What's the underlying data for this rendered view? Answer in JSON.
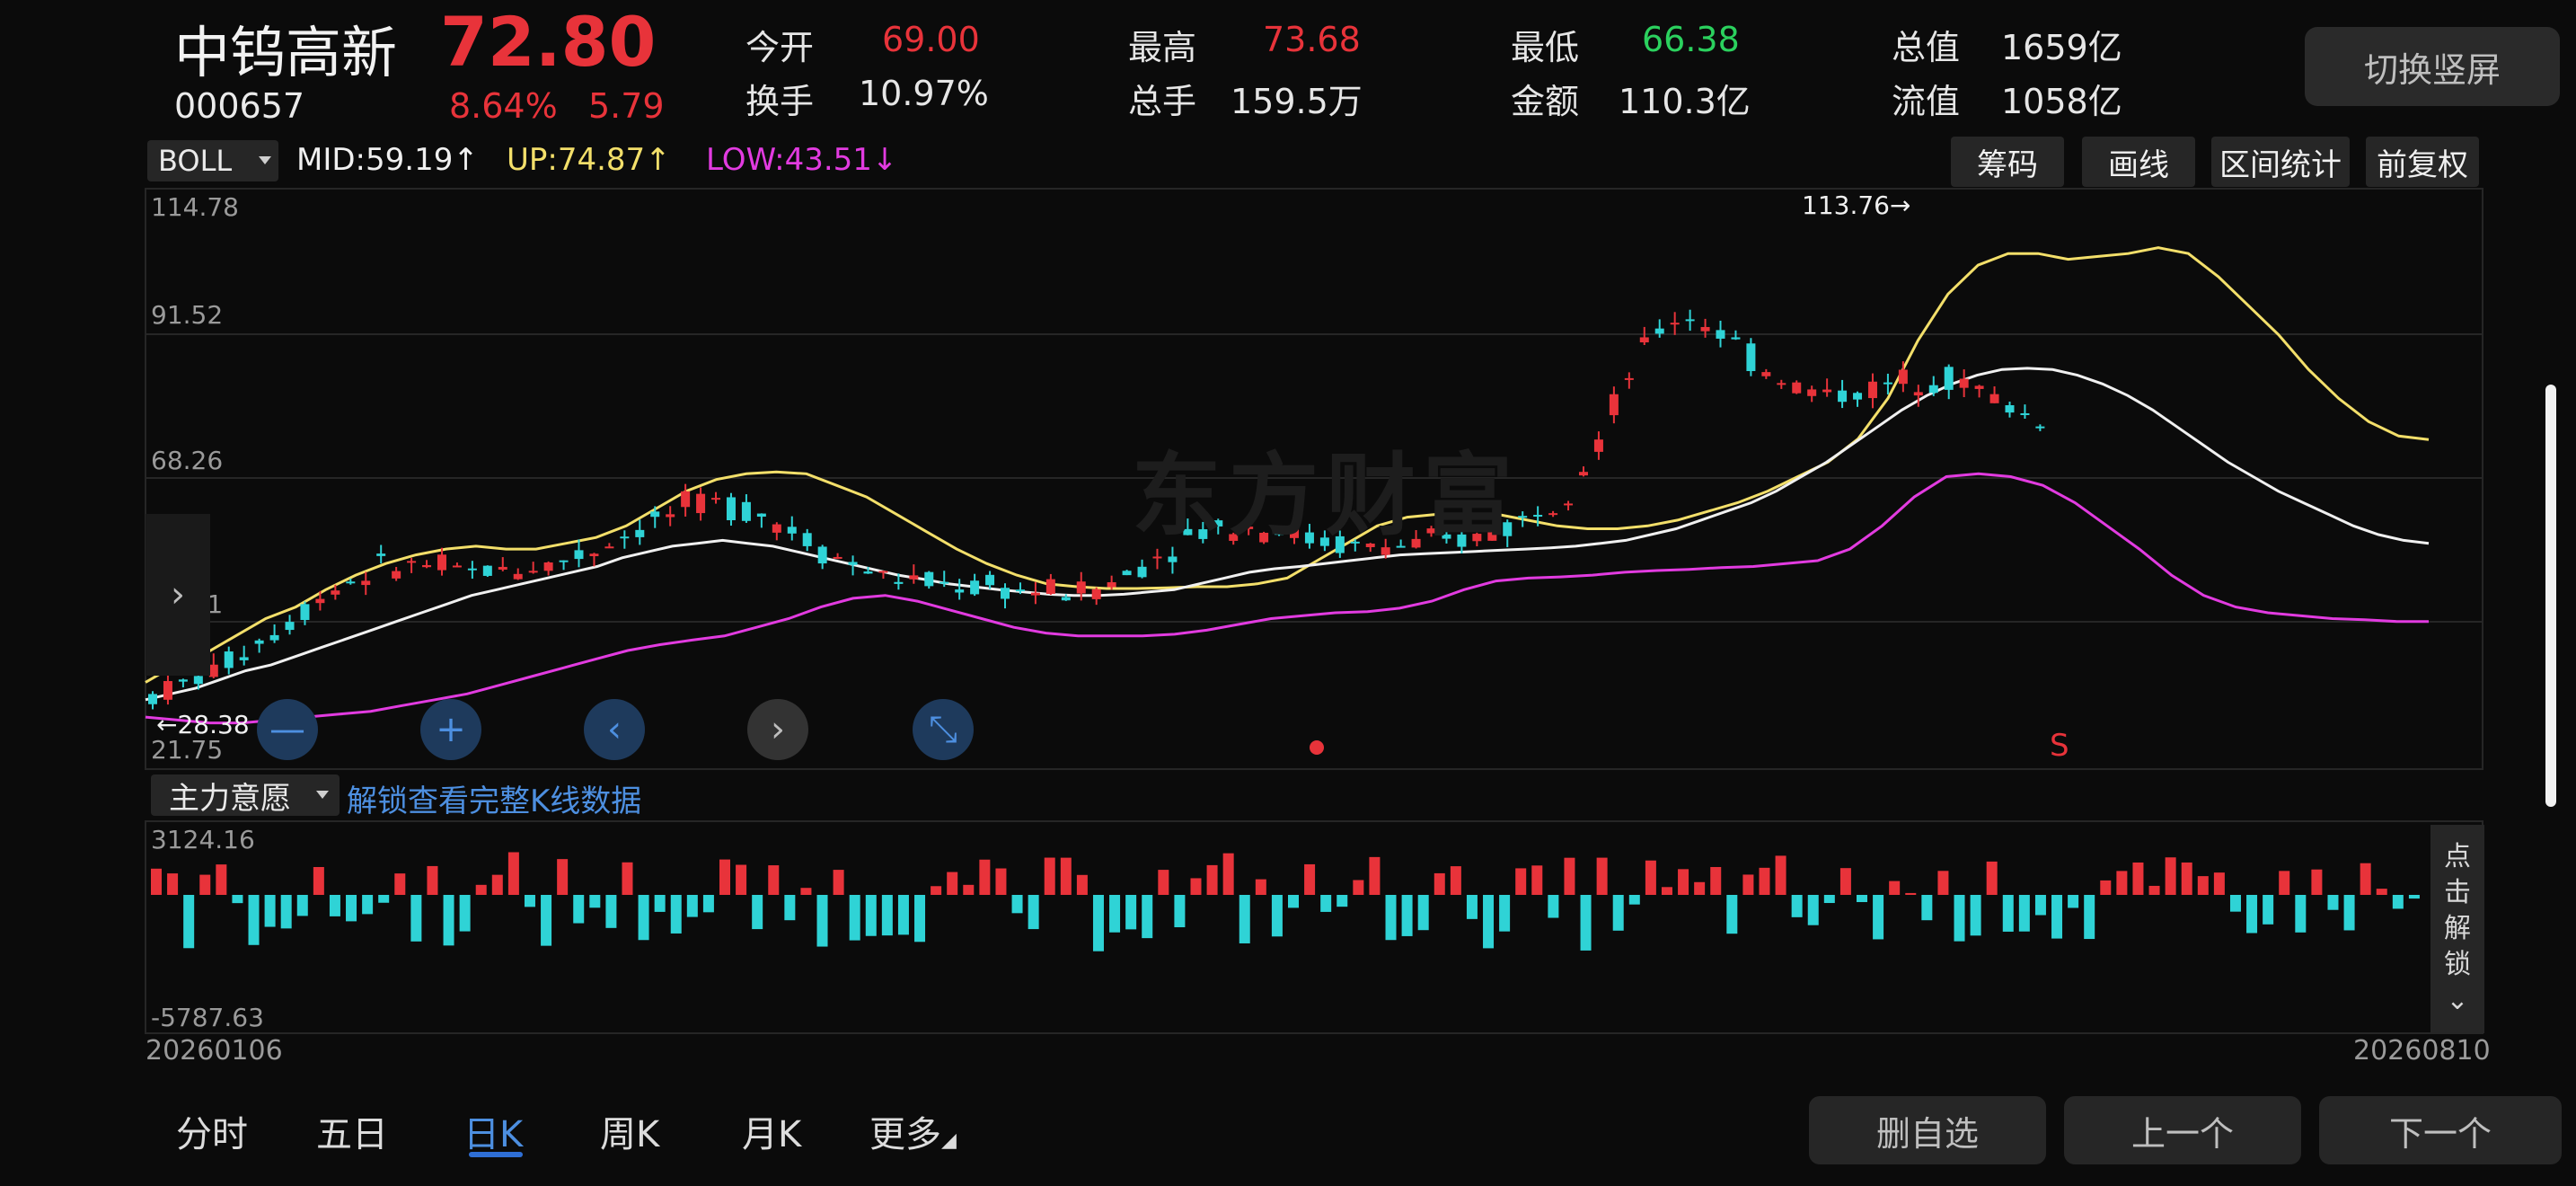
{
  "stock": {
    "name": "中钨高新",
    "code": "000657",
    "price": "72.80",
    "change_pct": "8.64%",
    "change_abs": "5.79"
  },
  "quote": [
    {
      "label": "今开",
      "value": "69.00",
      "color": "red"
    },
    {
      "label": "换手",
      "value": "10.97%",
      "color": "white"
    },
    {
      "label": "最高",
      "value": "73.68",
      "color": "red"
    },
    {
      "label": "总手",
      "value": "159.5万",
      "color": "white"
    },
    {
      "label": "最低",
      "value": "66.38",
      "color": "green"
    },
    {
      "label": "金额",
      "value": "110.3亿",
      "color": "white"
    },
    {
      "label": "总值",
      "value": "1659亿",
      "color": "white"
    },
    {
      "label": "流值",
      "value": "1058亿",
      "color": "white"
    }
  ],
  "switch_label": "切换竖屏",
  "indicator": {
    "name": "BOLL",
    "mid": "MID:59.19",
    "mid_arrow": "↑",
    "up": "UP:74.87",
    "up_arrow": "↑",
    "low": "LOW:43.51",
    "low_arrow": "↓"
  },
  "tools": [
    "筹码",
    "画线",
    "区间统计",
    "前复权"
  ],
  "price_axis": [
    "114.78",
    "91.52",
    "68.26",
    "45.01",
    "21.75"
  ],
  "annotations": {
    "high": "113.76",
    "low": "28.38",
    "signal": "S"
  },
  "watermark": "东方财富",
  "sub_panel": {
    "selector": "主力意愿",
    "unlock_text": "解锁查看完整K线数据",
    "axis_top": "3124.16",
    "axis_bottom": "-5787.63",
    "side_unlock_chars": [
      "点",
      "击",
      "解",
      "锁"
    ]
  },
  "dates": {
    "start": "20260106",
    "end": "20260810"
  },
  "period_tabs": [
    "分时",
    "五日",
    "日K",
    "周K",
    "月K",
    "更多"
  ],
  "active_tab": "日K",
  "bottom_buttons": [
    "删自选",
    "上一个",
    "下一个"
  ],
  "colors": {
    "up": "#e8333a",
    "down": "#2fd3d6",
    "mid_line": "#f0f0f0",
    "upper_line": "#f3df6a",
    "lower_line": "#e23be0",
    "accent": "#4d8fe0"
  },
  "chart_data": {
    "type": "candlestick",
    "ylim": [
      21.75,
      114.78
    ],
    "mid": [
      30,
      31,
      32,
      33.5,
      35,
      36,
      37.5,
      39,
      40.5,
      42,
      43.5,
      45,
      46.5,
      48,
      49,
      50,
      51,
      52,
      53,
      54.5,
      55.5,
      56.5,
      57,
      57.5,
      57,
      56.5,
      55.5,
      54.5,
      53.5,
      52.5,
      51.5,
      50.8,
      50,
      49.5,
      49,
      48.6,
      48.2,
      48,
      48,
      48.2,
      48.6,
      49,
      50,
      51,
      52,
      52.6,
      53,
      53.5,
      54,
      54.5,
      55,
      55.2,
      55.4,
      55.6,
      55.8,
      56,
      56.2,
      56.5,
      57,
      57.5,
      58.5,
      59.5,
      61,
      62.5,
      64,
      66,
      68.5,
      71,
      74,
      77,
      80,
      82.5,
      84.5,
      86,
      87,
      87.2,
      87,
      86,
      84.5,
      82.5,
      80,
      77,
      74,
      71,
      68.5,
      66,
      64,
      62,
      60,
      58.5,
      57.5,
      57
    ],
    "upper": [
      33,
      36,
      38,
      41,
      44,
      46,
      49,
      51.5,
      53.5,
      55,
      56,
      56.5,
      56,
      56,
      57,
      58,
      60,
      63,
      66,
      68,
      69,
      69.3,
      69,
      67,
      65,
      62,
      59,
      56,
      53.5,
      51.5,
      50,
      49.5,
      49.2,
      49.2,
      49.3,
      49.5,
      49.5,
      50,
      51,
      54,
      57,
      60,
      61.5,
      62,
      62,
      62,
      61,
      60,
      59.5,
      59.5,
      60,
      61,
      62.5,
      64,
      66,
      68.5,
      71,
      75,
      82,
      92,
      100,
      105,
      107,
      107,
      106,
      106.5,
      107,
      108,
      107,
      103,
      98,
      93,
      87,
      82,
      78,
      75.5,
      74.9
    ],
    "lower": [
      27,
      26.5,
      26,
      26,
      26.5,
      27,
      27.5,
      28,
      29,
      30,
      31,
      32.5,
      34,
      35.5,
      37,
      38.5,
      39.5,
      40.3,
      41,
      42.5,
      44,
      46,
      47.5,
      48,
      47,
      45.5,
      44,
      42.5,
      41.5,
      41,
      41,
      41,
      41.3,
      42,
      43,
      44,
      44.5,
      45,
      45.2,
      45.8,
      47,
      49,
      50.5,
      51,
      51.2,
      51.5,
      52,
      52.3,
      52.5,
      52.8,
      53,
      53.5,
      54,
      56,
      60,
      65,
      68.5,
      69,
      68.5,
      67,
      64,
      60,
      56,
      51.5,
      48,
      46,
      45,
      44.5,
      44,
      43.8,
      43.5,
      43.51
    ]
  }
}
